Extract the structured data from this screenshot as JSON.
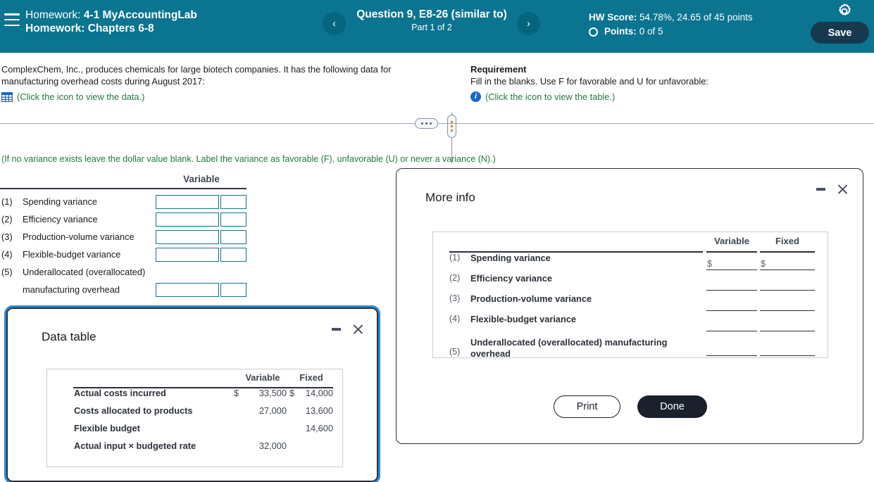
{
  "header": {
    "menu_icon": "hamburger-menu-icon",
    "homework_label": "Homework:",
    "course_title": "4-1 MyAccountingLab",
    "homework_chapters": "Homework: Chapters 6-8",
    "prev_icon": "‹",
    "next_icon": "›",
    "question_title": "Question 9, E8-26 (similar to)",
    "question_part": "Part 1 of 2",
    "hw_score_label": "HW Score:",
    "hw_score_value": "54.78%, 24.65 of 45 points",
    "points_label": "Points:",
    "points_value": "0 of 5",
    "gear_icon": "gear-icon",
    "save_label": "Save",
    "bg_color": "#0b7490",
    "save_color": "#16394e"
  },
  "problem": {
    "text": "ComplexChem, Inc., produces chemicals for large biotech companies. It has the following data for manufacturing overhead costs during August 2017:",
    "data_link": "(Click the icon to view the data.)",
    "grid_icon": "table-grid-icon",
    "requirement_title": "Requirement",
    "requirement_text": "Fill in the blanks. Use F for favorable and U for unfavorable:",
    "table_link": "(Click the icon to view the table.)",
    "info_icon": "info-circle-icon",
    "link_color": "#1f7a3f"
  },
  "answer": {
    "note": "(If no variance exists leave the dollar value blank. Label the variance as favorable (F), unfavorable (U) or never a variance (N).)",
    "column_header": "Variable",
    "rows": [
      {
        "num": "(1)",
        "label": "Spending variance",
        "value": "",
        "flag": ""
      },
      {
        "num": "(2)",
        "label": "Efficiency variance",
        "value": "",
        "flag": ""
      },
      {
        "num": "(3)",
        "label": "Production-volume variance",
        "value": "",
        "flag": ""
      },
      {
        "num": "(4)",
        "label": "Flexible-budget variance",
        "value": "",
        "flag": ""
      },
      {
        "num": "(5)",
        "label": "Underallocated (overallocated)",
        "value": "",
        "flag": ""
      },
      {
        "num": "",
        "label": "manufacturing overhead",
        "value": "",
        "flag": ""
      }
    ]
  },
  "more_info_modal": {
    "title": "More info",
    "minimize_icon": "minimize-icon",
    "close_icon": "close-icon",
    "col_variable": "Variable",
    "col_fixed": "Fixed",
    "dollar": "$",
    "rows": [
      {
        "num": "(1)",
        "label": "Spending variance"
      },
      {
        "num": "(2)",
        "label": "Efficiency variance"
      },
      {
        "num": "(3)",
        "label": "Production-volume variance"
      },
      {
        "num": "(4)",
        "label": "Flexible-budget variance"
      },
      {
        "num": "(5)",
        "label": "Underallocated (overallocated) manufacturing overhead"
      }
    ],
    "print_label": "Print",
    "done_label": "Done"
  },
  "data_table_modal": {
    "title": "Data table",
    "minimize_icon": "minimize-icon",
    "close_icon": "close-icon",
    "col_variable": "Variable",
    "col_fixed": "Fixed",
    "rows": [
      {
        "label": "Actual costs incurred",
        "var_dollar": "$",
        "variable": "33,500",
        "fixed_dollar": "$",
        "fixed": "14,000"
      },
      {
        "label": "Costs allocated to products",
        "var_dollar": "",
        "variable": "27,000",
        "fixed_dollar": "",
        "fixed": "13,600"
      },
      {
        "label": "Flexible budget",
        "var_dollar": "",
        "variable": "",
        "fixed_dollar": "",
        "fixed": "14,600"
      },
      {
        "label": "Actual input × budgeted rate",
        "var_dollar": "",
        "variable": "32,000",
        "fixed_dollar": "",
        "fixed": ""
      }
    ],
    "focus_color": "#2b8ad0"
  }
}
